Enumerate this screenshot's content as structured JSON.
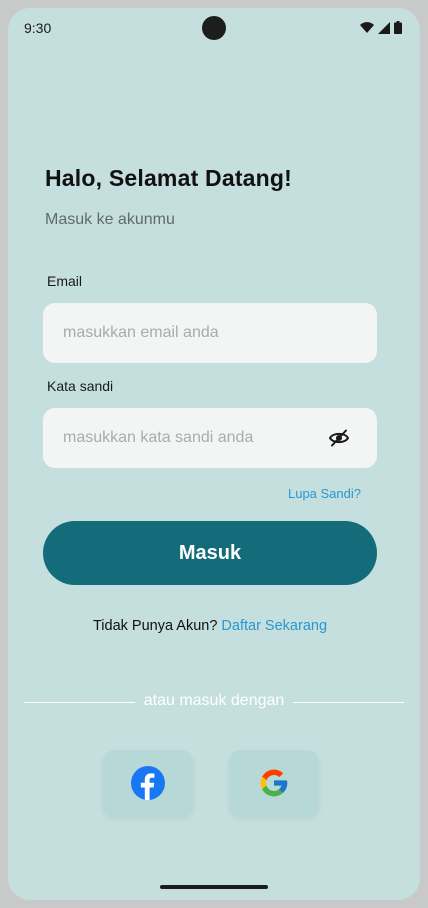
{
  "status_bar": {
    "time": "9:30"
  },
  "header": {
    "title": "Halo, Selamat Datang!",
    "subtitle": "Masuk ke akunmu"
  },
  "form": {
    "email_label": "Email",
    "email_placeholder": "masukkan email anda",
    "email_value": "",
    "password_label": "Kata sandi",
    "password_placeholder": "masukkan kata sandi anda",
    "password_value": "",
    "forgot_label": "Lupa Sandi?",
    "submit_label": "Masuk"
  },
  "register": {
    "prompt": "Tidak Punya Akun?",
    "link_label": "Daftar Sekarang"
  },
  "divider": {
    "label": "atau masuk dengan"
  },
  "social": [
    {
      "icon": "facebook-icon"
    },
    {
      "icon": "google-icon"
    }
  ],
  "colors": {
    "background": "#c5dfde",
    "primary": "#146b7a",
    "link": "#2a97cf",
    "input_bg": "#f3f4f4"
  }
}
